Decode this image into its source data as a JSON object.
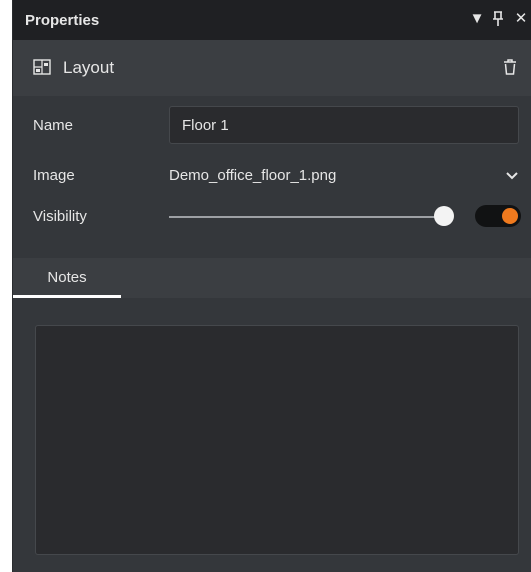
{
  "panel": {
    "title": "Properties",
    "controls": {
      "dropdown_icon": "caret-down-icon",
      "pin_icon": "pin-icon",
      "close_icon": "close-icon"
    }
  },
  "section": {
    "icon": "layout-icon",
    "label": "Layout",
    "delete_icon": "trash-icon"
  },
  "fields": {
    "name": {
      "label": "Name",
      "value": "Floor 1"
    },
    "image": {
      "label": "Image",
      "value": "Demo_office_floor_1.png"
    },
    "visibility": {
      "label": "Visibility",
      "slider_value": 1.0,
      "enabled": true
    }
  },
  "tabs": [
    {
      "label": "Notes",
      "active": true
    }
  ],
  "notes": {
    "value": ""
  },
  "colors": {
    "accent": "#f07a1e",
    "titlebar": "#1f2023",
    "panel": "#3b3e42",
    "input_bg": "#2a2b2e",
    "text": "#e6e6e6"
  }
}
